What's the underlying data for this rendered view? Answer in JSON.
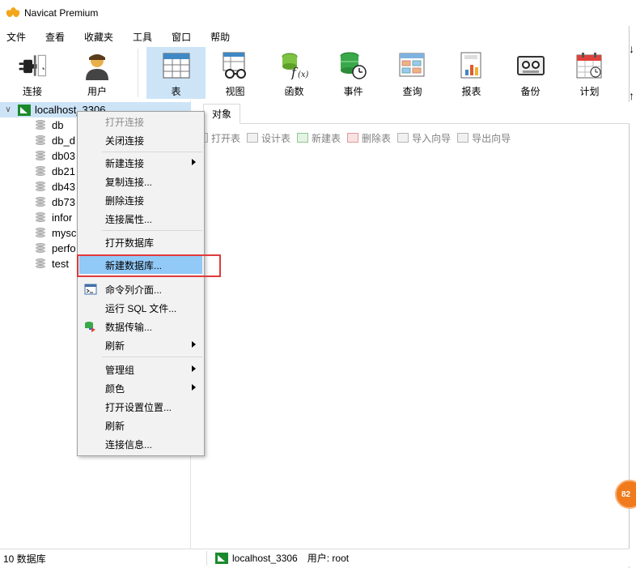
{
  "window": {
    "title": "Navicat Premium"
  },
  "menubar": [
    "文件",
    "查看",
    "收藏夹",
    "工具",
    "窗口",
    "帮助"
  ],
  "toolbar": {
    "connection": "连接",
    "user": "用户",
    "table": "表",
    "view": "视图",
    "function": "函数",
    "event": "事件",
    "query": "查询",
    "report": "报表",
    "backup": "备份",
    "schedule": "计划"
  },
  "tree": {
    "connection": "localhost_3306",
    "databases": [
      "db",
      "db_d",
      "db03",
      "db21",
      "db43",
      "db73",
      "infor",
      "mysc",
      "perfo",
      "test"
    ]
  },
  "tabs": {
    "objects": "对象"
  },
  "object_toolbar": {
    "open_table": "打开表",
    "design_table": "设计表",
    "new_table": "新建表",
    "delete_table": "删除表",
    "import_wizard": "导入向导",
    "export_wizard": "导出向导"
  },
  "context_menu": {
    "open_connection": "打开连接",
    "close_connection": "关闭连接",
    "new_connection": "新建连接",
    "copy_connection": "复制连接...",
    "delete_connection": "删除连接",
    "connection_properties": "连接属性...",
    "open_database": "打开数据库",
    "new_database": "新建数据库...",
    "console": "命令列介面...",
    "run_sql_file": "运行 SQL 文件...",
    "data_transfer": "数据传输...",
    "refresh_sub": "刷新",
    "manage_group": "管理组",
    "color": "颜色",
    "open_settings_location": "打开设置位置...",
    "refresh": "刷新",
    "connection_info": "连接信息..."
  },
  "status": {
    "db_count": "10 数据库",
    "connection": "localhost_3306",
    "user": "用户: root"
  },
  "edge": {
    "badge": "82"
  },
  "colors": {
    "accent": "#cde4f7",
    "menu_selected": "#91c9f7",
    "highlight_border": "#e03b3b",
    "mysql_green": "#1a8a2c"
  }
}
